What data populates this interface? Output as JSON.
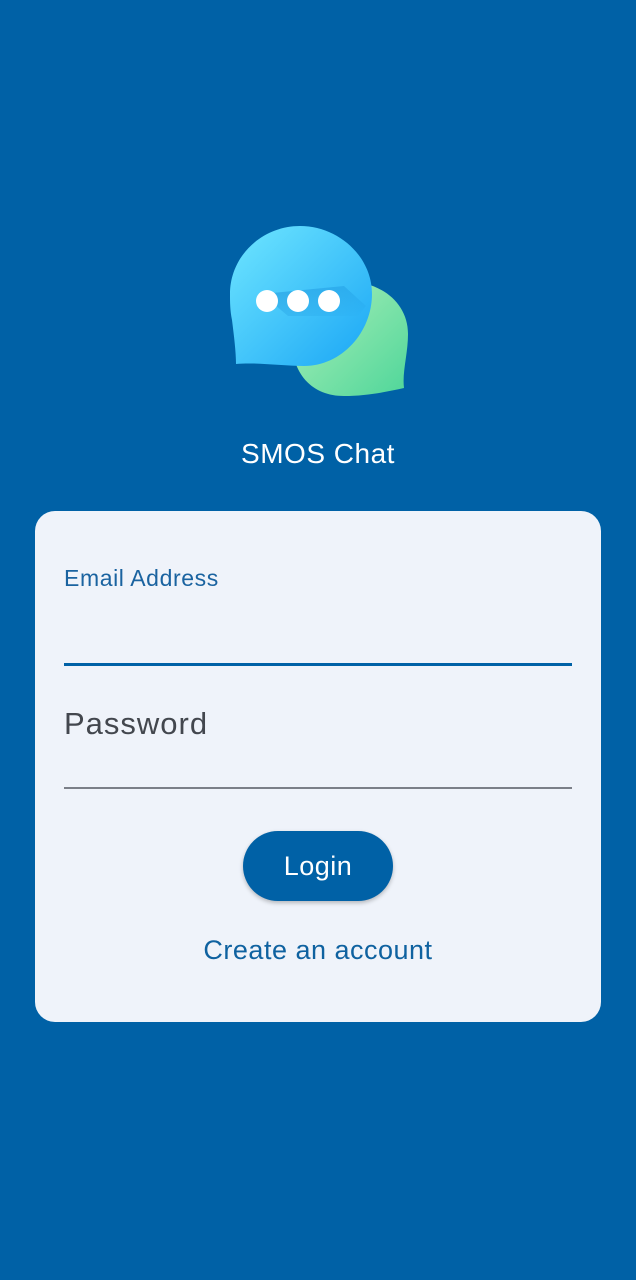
{
  "app": {
    "title": "SMOS Chat",
    "logo_icon": "chat-bubbles-icon"
  },
  "login_form": {
    "email": {
      "label": "Email Address",
      "value": "",
      "placeholder": ""
    },
    "password": {
      "label": "Password",
      "value": "",
      "placeholder": ""
    },
    "login_button_label": "Login",
    "create_account_label": "Create an account"
  },
  "colors": {
    "background": "#0061a6",
    "card": "#eff3fa",
    "primary": "#0061a6",
    "bubble_blue": "#4fc3f7",
    "bubble_green": "#7ee0a0"
  }
}
